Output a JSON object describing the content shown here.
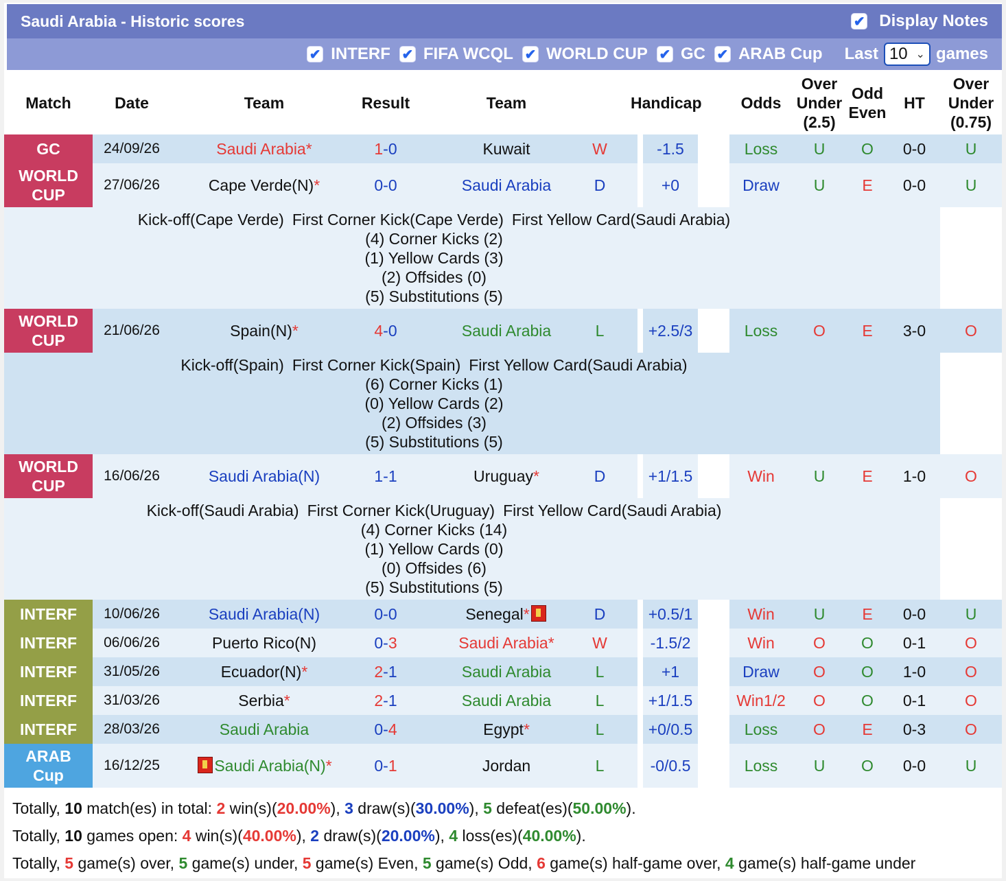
{
  "header": {
    "title": "Saudi Arabia - Historic scores",
    "display_notes_label": "Display Notes"
  },
  "filters": {
    "items": [
      "INTERF",
      "FIFA WCQL",
      "WORLD CUP",
      "GC",
      "ARAB Cup"
    ],
    "last_label": "Last",
    "games_value": "10",
    "games_label": "games"
  },
  "columns": [
    "Match",
    "Date",
    "Team",
    "Result",
    "Team",
    "Handicap",
    "Odds",
    "Over Under (2.5)",
    "Odd Even",
    "HT",
    "Over Under (0.75)"
  ],
  "matches": [
    {
      "comp": "GC",
      "date": "24/09/26",
      "home": "Saudi Arabia",
      "home_star": "*",
      "score_h": "1",
      "score_a": "0",
      "away": "Kuwait",
      "away_star": "",
      "wdl": "W",
      "handicap": "-1.5",
      "odds": "Loss",
      "ou": "U",
      "oe": "O",
      "ht": "0-0",
      "ou2": "U"
    },
    {
      "comp": "WORLD CUP",
      "date": "27/06/26",
      "home": "Cape Verde(N)",
      "home_star": "*",
      "score_h": "0",
      "score_a": "0",
      "away": "Saudi Arabia",
      "away_star": "",
      "wdl": "D",
      "handicap": "+0",
      "odds": "Draw",
      "ou": "U",
      "oe": "E",
      "ht": "0-0",
      "ou2": "U",
      "notes": {
        "kickoff": "Kick-off(Cape Verde)",
        "corner": "First Corner Kick(Cape Verde)",
        "yellow": "First Yellow Card(Saudi Arabia)",
        "corners": "(4) Corner Kicks (2)",
        "yellows": "(1) Yellow Cards (3)",
        "offsides": "(2) Offsides (0)",
        "subs": "(5) Substitutions (5)"
      }
    },
    {
      "comp": "WORLD CUP",
      "date": "21/06/26",
      "home": "Spain(N)",
      "home_star": "*",
      "score_h": "4",
      "score_a": "0",
      "away": "Saudi Arabia",
      "away_star": "",
      "wdl": "L",
      "handicap": "+2.5/3",
      "odds": "Loss",
      "ou": "O",
      "oe": "E",
      "ht": "3-0",
      "ou2": "O",
      "notes": {
        "kickoff": "Kick-off(Spain)",
        "corner": "First Corner Kick(Spain)",
        "yellow": "First Yellow Card(Saudi Arabia)",
        "corners": "(6) Corner Kicks (1)",
        "yellows": "(0) Yellow Cards (2)",
        "offsides": "(2) Offsides (3)",
        "subs": "(5) Substitutions (5)"
      }
    },
    {
      "comp": "WORLD CUP",
      "date": "16/06/26",
      "home": "Saudi Arabia(N)",
      "home_star": "",
      "score_h": "1",
      "score_a": "1",
      "away": "Uruguay",
      "away_star": "*",
      "wdl": "D",
      "handicap": "+1/1.5",
      "odds": "Win",
      "ou": "U",
      "oe": "E",
      "ht": "1-0",
      "ou2": "O",
      "notes": {
        "kickoff": "Kick-off(Saudi Arabia)",
        "corner": "First Corner Kick(Uruguay)",
        "yellow": "First Yellow Card(Saudi Arabia)",
        "corners": "(4) Corner Kicks (14)",
        "yellows": "(1) Yellow Cards (0)",
        "offsides": "(0) Offsides (6)",
        "subs": "(5) Substitutions (5)"
      }
    },
    {
      "comp": "INTERF",
      "date": "10/06/26",
      "home": "Saudi Arabia(N)",
      "home_star": "",
      "score_h": "0",
      "score_a": "0",
      "away": "Senegal",
      "away_star": "*",
      "wdl": "D",
      "handicap": "+0.5/1",
      "odds": "Win",
      "ou": "U",
      "oe": "E",
      "ht": "0-0",
      "ou2": "U"
    },
    {
      "comp": "INTERF",
      "date": "06/06/26",
      "home": "Puerto Rico(N)",
      "home_star": "",
      "score_h": "0",
      "score_a": "3",
      "away": "Saudi Arabia",
      "away_star": "*",
      "wdl": "W",
      "handicap": "-1.5/2",
      "odds": "Win",
      "ou": "O",
      "oe": "O",
      "ht": "0-1",
      "ou2": "O"
    },
    {
      "comp": "INTERF",
      "date": "31/05/26",
      "home": "Ecuador(N)",
      "home_star": "*",
      "score_h": "2",
      "score_a": "1",
      "away": "Saudi Arabia",
      "away_star": "",
      "wdl": "L",
      "handicap": "+1",
      "odds": "Draw",
      "ou": "O",
      "oe": "O",
      "ht": "1-0",
      "ou2": "O"
    },
    {
      "comp": "INTERF",
      "date": "31/03/26",
      "home": "Serbia",
      "home_star": "*",
      "score_h": "2",
      "score_a": "1",
      "away": "Saudi Arabia",
      "away_star": "",
      "wdl": "L",
      "handicap": "+1/1.5",
      "odds": "Win1/2",
      "ou": "O",
      "oe": "O",
      "ht": "0-1",
      "ou2": "O"
    },
    {
      "comp": "INTERF",
      "date": "28/03/26",
      "home": "Saudi Arabia",
      "home_star": "",
      "score_h": "0",
      "score_a": "4",
      "away": "Egypt",
      "away_star": "*",
      "wdl": "L",
      "handicap": "+0/0.5",
      "odds": "Loss",
      "ou": "O",
      "oe": "E",
      "ht": "0-3",
      "ou2": "O"
    },
    {
      "comp": "ARAB Cup",
      "date": "16/12/25",
      "home": "Saudi Arabia(N)",
      "home_star": "*",
      "score_h": "0",
      "score_a": "1",
      "away": "Jordan",
      "away_star": "",
      "wdl": "L",
      "handicap": "-0/0.5",
      "odds": "Loss",
      "ou": "U",
      "oe": "O",
      "ht": "0-0",
      "ou2": "U"
    }
  ],
  "totals": {
    "line1": {
      "p1": "Totally, ",
      "n": "10",
      "p2": " match(es) in total: ",
      "w": "2",
      "p3": " win(s)(",
      "wp": "20.00%",
      "p4": "), ",
      "d": "3",
      "p5": " draw(s)(",
      "dp": "30.00%",
      "p6": "), ",
      "l": "5",
      "p7": " defeat(es)(",
      "lp": "50.00%",
      "p8": ")."
    },
    "line2": {
      "p1": "Totally, ",
      "n": "10",
      "p2": " games open: ",
      "w": "4",
      "p3": " win(s)(",
      "wp": "40.00%",
      "p4": "), ",
      "d": "2",
      "p5": " draw(s)(",
      "dp": "20.00%",
      "p6": "), ",
      "l": "4",
      "p7": " loss(es)(",
      "lp": "40.00%",
      "p8": ")."
    },
    "line3": {
      "p1": "Totally, ",
      "over": "5",
      "p2": " game(s) over, ",
      "under": "5",
      "p3": " game(s) under, ",
      "even": "5",
      "p4": " game(s) Even, ",
      "odd": "5",
      "p5": " game(s) Odd, ",
      "hover": "6",
      "p6": " game(s) half-game over, ",
      "hunder": "4",
      "p7": " game(s) half-game under"
    }
  },
  "colors": {
    "gc_wc": "#c83c60",
    "interf": "#949f47",
    "arab": "#4ea5e0",
    "title_bar": "#6b7ac2",
    "filter_bar": "#8d9ad6"
  }
}
